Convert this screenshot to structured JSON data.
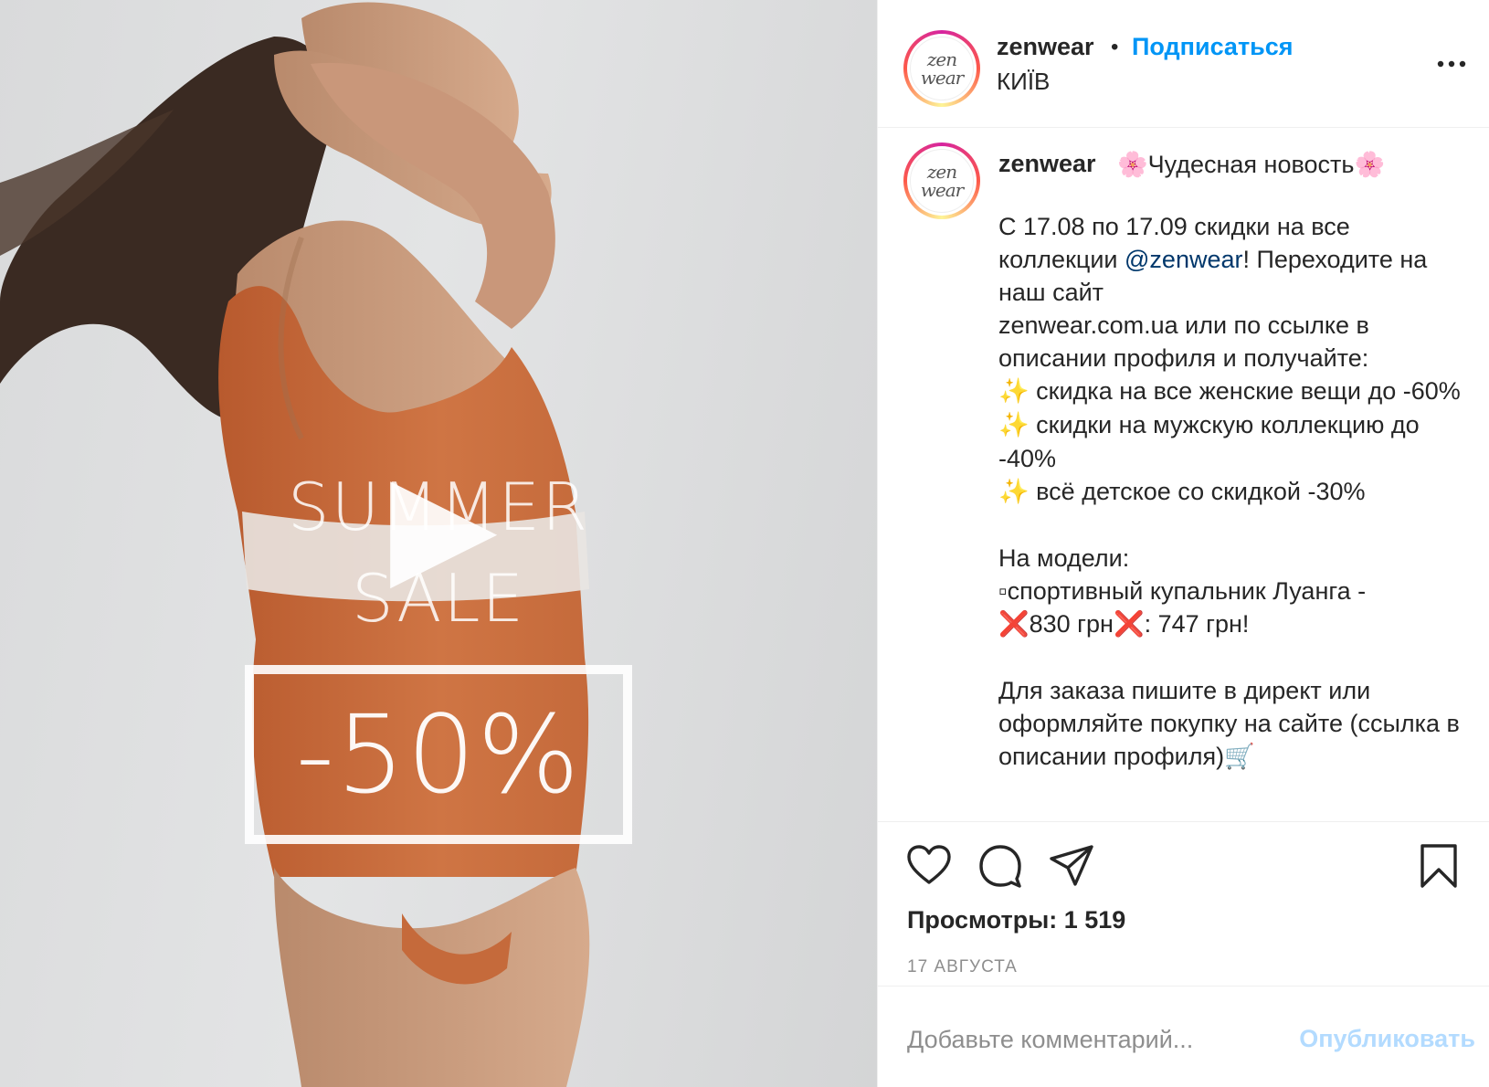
{
  "colors": {
    "accent": "#0095f6",
    "link": "#00376b",
    "muted": "#8e8e8e",
    "publish_disabled": "#b3dbff",
    "swimsuit": "#c8693a"
  },
  "media": {
    "overlay": {
      "line1": "SUMMER",
      "line2": "SALE",
      "discount": "-50%"
    },
    "play_icon": "play-icon"
  },
  "header": {
    "avatar_logo": [
      "zen",
      "wear"
    ],
    "username": "zenwear",
    "separator": "•",
    "follow_label": "Подписаться",
    "location": "КИЇВ",
    "more_icon": "more-horizontal-icon"
  },
  "caption": {
    "username": "zenwear",
    "title_emoji": "🌸",
    "title_text": "Чудесная новость",
    "line_dates_pre": "С 17.08 по 17.09 скидки на все коллекции ",
    "mention": "@zenwear",
    "line_dates_post": "! Переходите на наш сайт",
    "line_site": "zenwear.com.ua или по ссылке в описании профиля и получайте:",
    "bullet_emoji": "✨",
    "bullets": [
      "скидка на все женские вещи до -60%",
      "скидки на мужскую коллекцию до -40%",
      "всё детское со скидкой -30%"
    ],
    "model_heading": "На модели:",
    "model_item": "▫спортивный купальник Луанга -",
    "cross_emoji": "❌",
    "old_price": "830 грн",
    "new_price": ": 747 грн!",
    "order_text": "Для заказа пишите в директ или оформляйте покупку на сайте (ссылка в описании профиля)",
    "cart_emoji": "🛒"
  },
  "actions": {
    "icons": [
      "heart-icon",
      "comment-icon",
      "share-icon",
      "bookmark-icon"
    ],
    "views": "Просмотры: 1 519",
    "date": "17 АВГУСТА"
  },
  "comment": {
    "placeholder": "Добавьте комментарий...",
    "publish_label": "Опубликовать"
  }
}
